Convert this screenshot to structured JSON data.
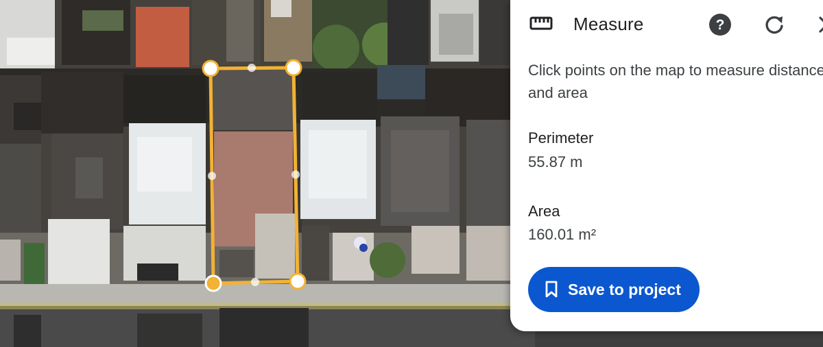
{
  "panel": {
    "title": "Measure",
    "description": "Click points on the map to measure distance and area",
    "perimeter_label": "Perimeter",
    "perimeter_value": "55.87 m",
    "area_label": "Area",
    "area_value": "160.01 m²",
    "save_label": "Save to project",
    "icons": [
      "ruler-icon",
      "help-icon",
      "refresh-icon",
      "close-icon",
      "bookmark-icon"
    ]
  },
  "colors": {
    "accent": "#0b57d0",
    "measure_outline": "#f2b233",
    "vertex_fill": "#ffffff",
    "panel_bg": "#ffffff"
  }
}
